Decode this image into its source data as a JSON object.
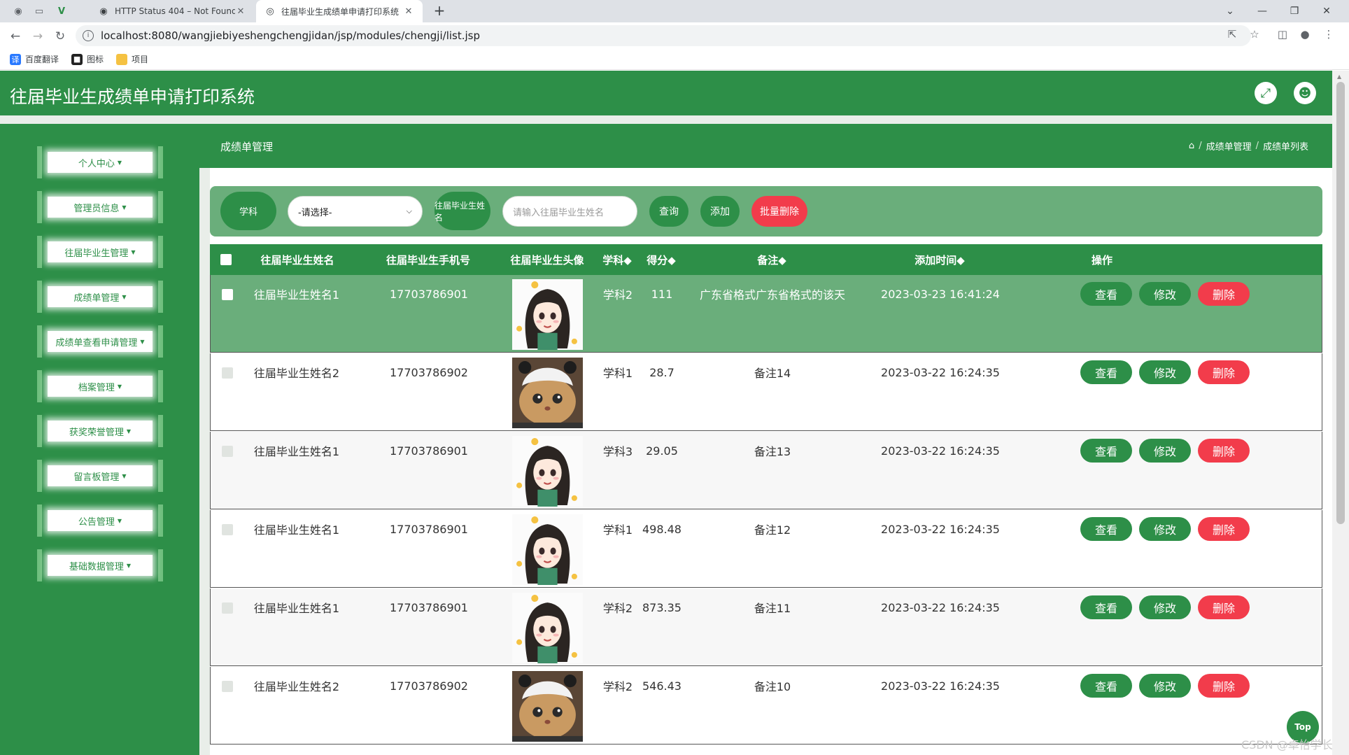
{
  "browser": {
    "tabs": [
      {
        "title": "HTTP Status 404 – Not Found",
        "icon": "globe-icon"
      },
      {
        "title": "往届毕业生成绩单申请打印系统",
        "icon": "site-icon"
      }
    ],
    "url": "localhost:8080/wangjiebiyeshengchengjidan/jsp/modules/chengji/list.jsp",
    "bookmarks": [
      {
        "label": "百度翻译",
        "icon": "translate-icon",
        "color": "#2979ff"
      },
      {
        "label": "图标",
        "icon": "app-icon",
        "color": "#222222"
      },
      {
        "label": "项目",
        "icon": "folder-icon",
        "color": "#f5c242"
      }
    ]
  },
  "app": {
    "title": "往届毕业生成绩单申请打印系统",
    "accent_color": "#2d8f48",
    "danger_color": "#f23c4b"
  },
  "sidebar": {
    "items": [
      {
        "label": "个人中心"
      },
      {
        "label": "管理员信息"
      },
      {
        "label": "往届毕业生管理"
      },
      {
        "label": "成绩单管理"
      },
      {
        "label": "成绩单查看申请管理"
      },
      {
        "label": "档案管理"
      },
      {
        "label": "获奖荣誉管理"
      },
      {
        "label": "留言板管理"
      },
      {
        "label": "公告管理"
      },
      {
        "label": "基础数据管理"
      }
    ]
  },
  "page": {
    "title": "成绩单管理",
    "breadcrumbs": [
      "成绩单管理",
      "成绩单列表"
    ]
  },
  "search": {
    "subject_label": "学科",
    "subject_select_value": "-请选择-",
    "name_label": "往届毕业生姓名",
    "name_placeholder": "请输入往届毕业生姓名",
    "query_label": "查询",
    "add_label": "添加",
    "batch_delete_label": "批量删除"
  },
  "table": {
    "headers": [
      "往届毕业生姓名",
      "往届毕业生手机号",
      "往届毕业生头像",
      "学科◆",
      "得分◆",
      "备注◆",
      "添加时间◆",
      "操作"
    ],
    "action_labels": {
      "view": "查看",
      "edit": "修改",
      "delete": "删除"
    },
    "rows": [
      {
        "name": "往届毕业生姓名1",
        "phone": "17703786901",
        "avatar": "girl",
        "subject": "学科2",
        "score": "111",
        "remark": "广东省格式广东省格式的该天",
        "time": "2023-03-23 16:41:24"
      },
      {
        "name": "往届毕业生姓名2",
        "phone": "17703786902",
        "avatar": "cat",
        "subject": "学科1",
        "score": "28.7",
        "remark": "备注14",
        "time": "2023-03-22 16:24:35"
      },
      {
        "name": "往届毕业生姓名1",
        "phone": "17703786901",
        "avatar": "girl",
        "subject": "学科3",
        "score": "29.05",
        "remark": "备注13",
        "time": "2023-03-22 16:24:35"
      },
      {
        "name": "往届毕业生姓名1",
        "phone": "17703786901",
        "avatar": "girl",
        "subject": "学科1",
        "score": "498.48",
        "remark": "备注12",
        "time": "2023-03-22 16:24:35"
      },
      {
        "name": "往届毕业生姓名1",
        "phone": "17703786901",
        "avatar": "girl",
        "subject": "学科2",
        "score": "873.35",
        "remark": "备注11",
        "time": "2023-03-22 16:24:35"
      },
      {
        "name": "往届毕业生姓名2",
        "phone": "17703786902",
        "avatar": "cat",
        "subject": "学科2",
        "score": "546.43",
        "remark": "备注10",
        "time": "2023-03-22 16:24:35"
      }
    ]
  },
  "top_button": "Top",
  "watermark": "CSDN @卓怡学长"
}
